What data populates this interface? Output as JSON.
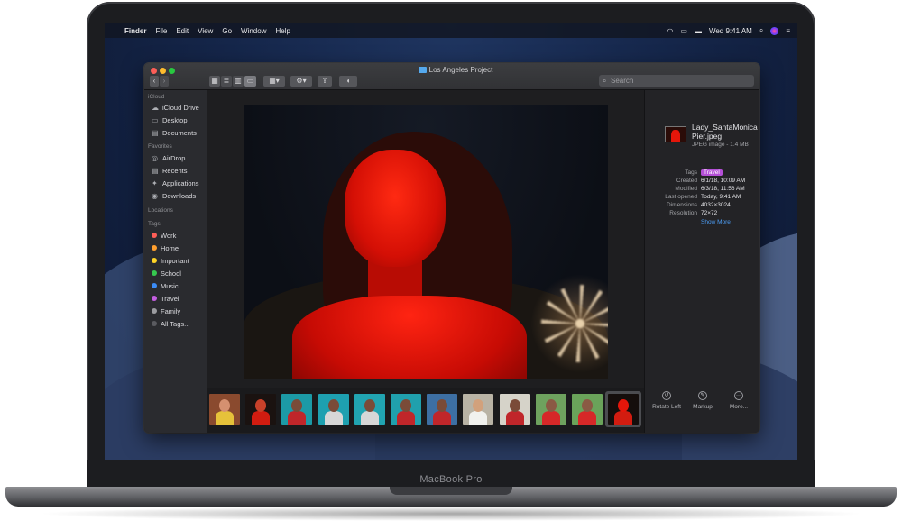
{
  "device": {
    "brand": "MacBook Pro"
  },
  "menubar": {
    "app": "Finder",
    "menus": [
      "File",
      "Edit",
      "View",
      "Go",
      "Window",
      "Help"
    ],
    "clock": "Wed 9:41 AM",
    "icons": [
      "apple-icon",
      "wifi-icon",
      "airplay-icon",
      "battery-icon",
      "spotlight-icon",
      "siri-icon",
      "control-icon"
    ]
  },
  "window": {
    "title": "Los Angeles Project",
    "search_placeholder": "Search"
  },
  "sidebar": {
    "sections": [
      {
        "header": "iCloud",
        "items": [
          {
            "label": "iCloud Drive",
            "icon": "cloud-icon"
          },
          {
            "label": "Desktop",
            "icon": "desktop-icon"
          },
          {
            "label": "Documents",
            "icon": "document-icon"
          }
        ]
      },
      {
        "header": "Favorites",
        "items": [
          {
            "label": "AirDrop",
            "icon": "airdrop-icon"
          },
          {
            "label": "Recents",
            "icon": "clock-icon"
          },
          {
            "label": "Applications",
            "icon": "applications-icon"
          },
          {
            "label": "Downloads",
            "icon": "download-icon"
          }
        ]
      },
      {
        "header": "Locations",
        "items": []
      },
      {
        "header": "Tags",
        "items": [
          {
            "label": "Work",
            "color": "#ff5e57"
          },
          {
            "label": "Home",
            "color": "#ff9f2e"
          },
          {
            "label": "Important",
            "color": "#ffd426"
          },
          {
            "label": "School",
            "color": "#36c84f"
          },
          {
            "label": "Music",
            "color": "#3b8cf6"
          },
          {
            "label": "Travel",
            "color": "#c35ee0"
          },
          {
            "label": "Family",
            "color": "#9b9ca0"
          },
          {
            "label": "All Tags...",
            "color": "#5a5b60"
          }
        ]
      }
    ]
  },
  "preview": {
    "thumbnails": [
      {
        "bg": "#8a4a2e",
        "skin": "#d59070",
        "shirt": "#e6c23a"
      },
      {
        "bg": "#1a1210",
        "skin": "#c8412a",
        "shirt": "#d21c10"
      },
      {
        "bg": "#1c9aa6",
        "skin": "#7a4b38",
        "shirt": "#c0262a"
      },
      {
        "bg": "#1ea0b0",
        "skin": "#7a4b38",
        "shirt": "#d7d7d7"
      },
      {
        "bg": "#21a4b1",
        "skin": "#7a4b38",
        "shirt": "#d7d7d7"
      },
      {
        "bg": "#20a0ad",
        "skin": "#7a4b38",
        "shirt": "#c0262a"
      },
      {
        "bg": "#3d6fa3",
        "skin": "#7a4b38",
        "shirt": "#c0262a"
      },
      {
        "bg": "#b9b3a5",
        "skin": "#d2a17c",
        "shirt": "#f1f1ee"
      },
      {
        "bg": "#d6d3c9",
        "skin": "#7a4b38",
        "shirt": "#c0262a"
      },
      {
        "bg": "#6ea25e",
        "skin": "#8a5a44",
        "shirt": "#d62828"
      },
      {
        "bg": "#6aa35a",
        "skin": "#8a5a44",
        "shirt": "#d62828"
      },
      {
        "bg": "#140e0c",
        "skin": "#e5160a",
        "shirt": "#d21c10"
      }
    ],
    "selected_index": 11
  },
  "inspector": {
    "file_name": "Lady_SantaMonicaPier.jpeg",
    "file_kind": "JPEG image - 1.4 MB",
    "rows": [
      {
        "key": "Tags",
        "value": "Travel"
      },
      {
        "key": "Created",
        "value": "6/1/18, 10:09 AM"
      },
      {
        "key": "Modified",
        "value": "6/3/18, 11:56 AM"
      },
      {
        "key": "Last opened",
        "value": "Today, 9:41 AM"
      },
      {
        "key": "Dimensions",
        "value": "4032×3024"
      },
      {
        "key": "Resolution",
        "value": "72×72"
      }
    ],
    "show_more": "Show More",
    "tag_color": "#b44fd6",
    "actions": [
      {
        "label": "Rotate Left",
        "icon": "rotate-left-icon"
      },
      {
        "label": "Markup",
        "icon": "markup-icon"
      },
      {
        "label": "More...",
        "icon": "more-icon"
      }
    ]
  }
}
